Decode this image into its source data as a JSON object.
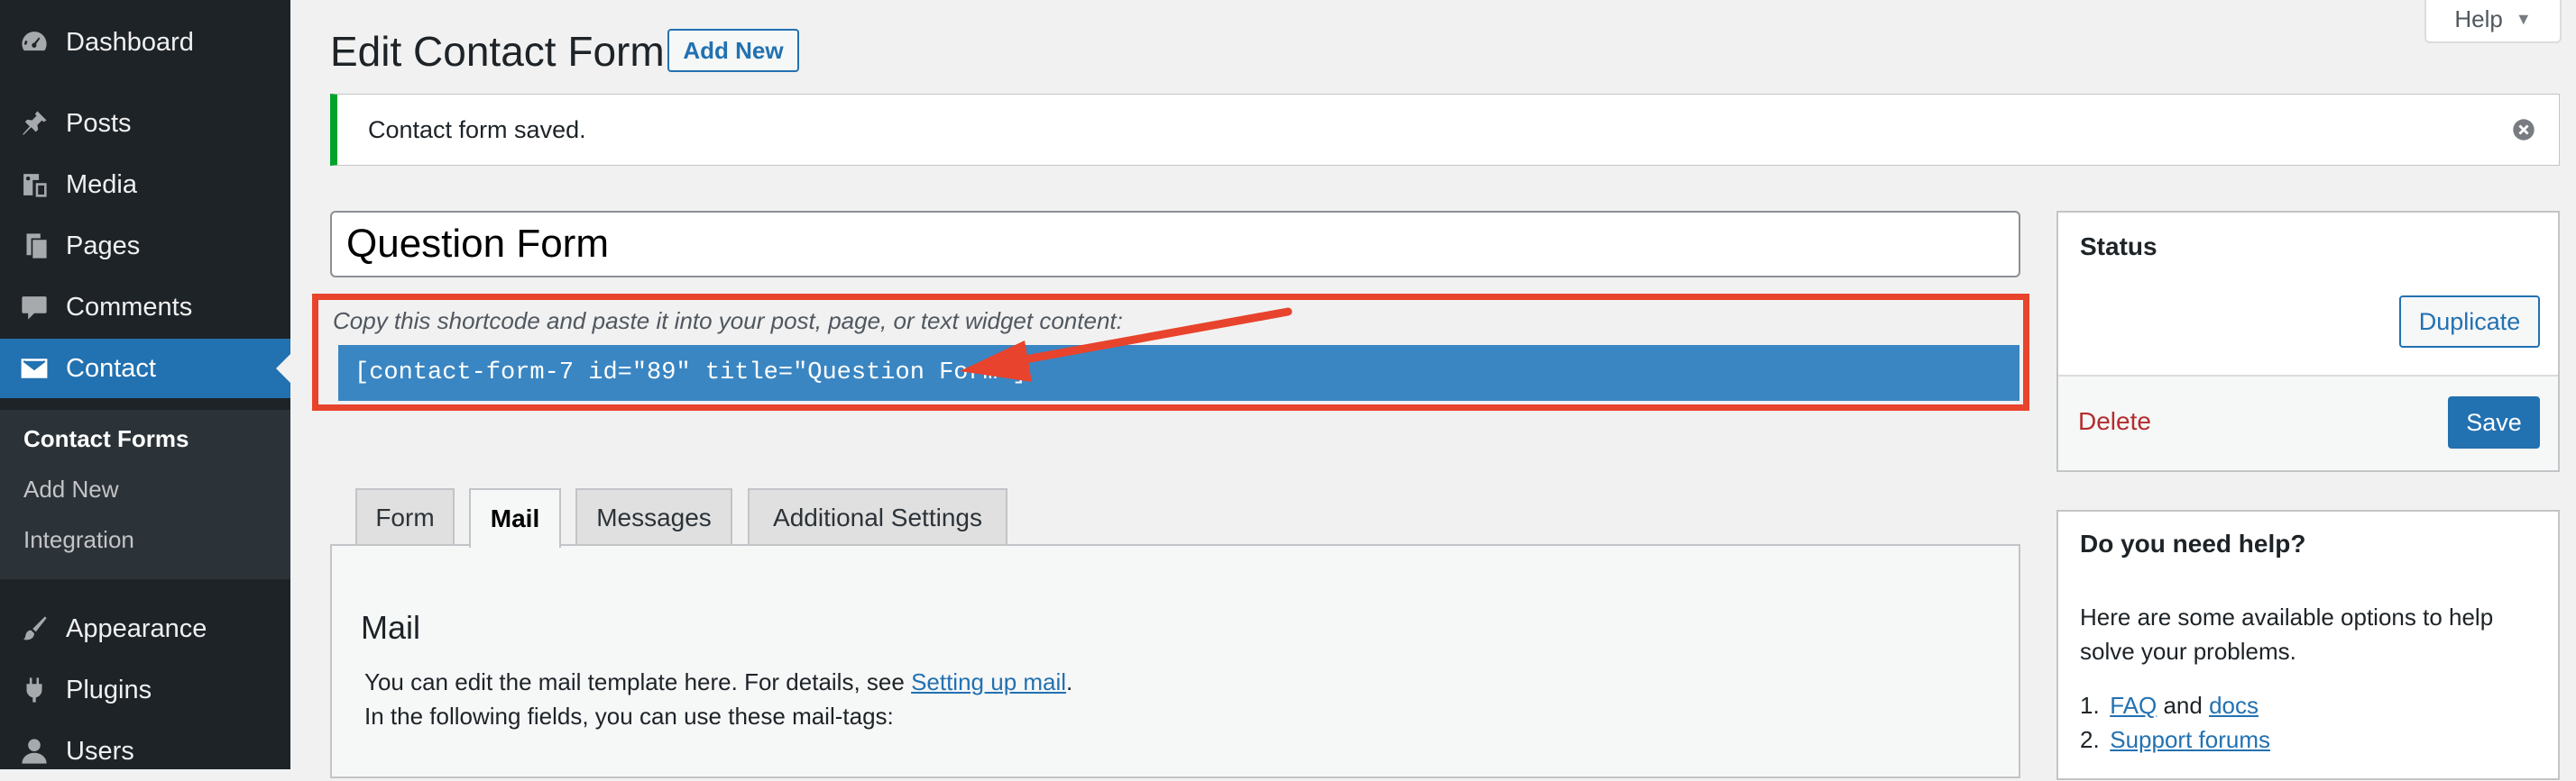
{
  "sidebar": {
    "items": [
      {
        "label": "Dashboard",
        "icon": "dashboard-icon"
      },
      {
        "label": "Posts",
        "icon": "pin-icon"
      },
      {
        "label": "Media",
        "icon": "media-icon"
      },
      {
        "label": "Pages",
        "icon": "pages-icon"
      },
      {
        "label": "Comments",
        "icon": "comment-icon"
      },
      {
        "label": "Contact",
        "icon": "mail-icon"
      },
      {
        "label": "Appearance",
        "icon": "brush-icon"
      },
      {
        "label": "Plugins",
        "icon": "plug-icon"
      },
      {
        "label": "Users",
        "icon": "user-icon"
      }
    ],
    "submenu": [
      "Contact Forms",
      "Add New",
      "Integration"
    ],
    "accent_color": "#2271b1"
  },
  "header": {
    "title": "Edit Contact Form",
    "add_new_label": "Add New",
    "help_label": "Help"
  },
  "notice": {
    "text": "Contact form saved.",
    "color": "#00a32a"
  },
  "form": {
    "title_value": "Question Form",
    "shortcode_hint": "Copy this shortcode and paste it into your post, page, or text widget content:",
    "shortcode": "[contact-form-7 id=\"89\" title=\"Question Form\"]",
    "highlight_color": "#e8432c"
  },
  "tabs": [
    {
      "label": "Form",
      "active": false
    },
    {
      "label": "Mail",
      "active": true
    },
    {
      "label": "Messages",
      "active": false
    },
    {
      "label": "Additional Settings",
      "active": false
    }
  ],
  "panel": {
    "title": "Mail",
    "line1_prefix": "You can edit the mail template here. For details, see ",
    "line1_link": "Setting up mail",
    "line1_suffix": ".",
    "line2": "In the following fields, you can use these mail-tags:"
  },
  "status_box": {
    "heading": "Status",
    "duplicate_label": "Duplicate",
    "delete_label": "Delete",
    "save_label": "Save"
  },
  "help_box": {
    "heading": "Do you need help?",
    "text": "Here are some available options to help solve your problems.",
    "list": [
      {
        "num": "1.",
        "link1": "FAQ",
        "middle": " and ",
        "link2": "docs"
      },
      {
        "num": "2.",
        "link1": "Support forums"
      }
    ]
  }
}
